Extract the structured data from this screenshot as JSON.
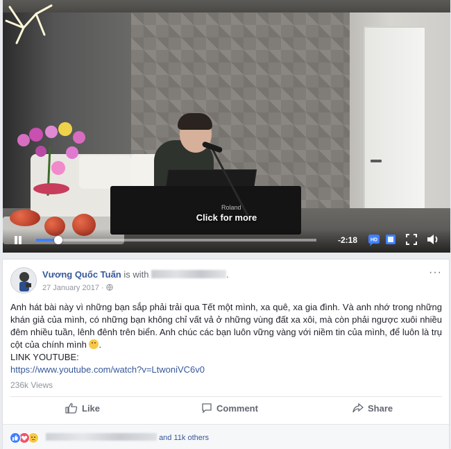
{
  "video": {
    "overlay_text": "Click for more",
    "time_remaining": "-2:18",
    "progress": 0.08,
    "piano_brand": "Roland",
    "hd_label": "HD"
  },
  "post": {
    "author": "Vương Quốc Tuấn",
    "with_text": "is with",
    "date": "27 January 2017",
    "privacy_icon": "globe-icon",
    "body": "Anh hát bài này vì những bạn sắp phải trải qua Tết một mình, xa quê, xa gia đình. Và anh nhớ trong những khán giả của mình, có những bạn không chỉ vất vả ở những vùng đất xa xôi, mà còn phải ngược xuôi nhiều đêm nhiều tuần, lênh đênh trên biển. Anh chúc các bạn luôn vững vàng với niềm tin của mình, để luôn là trụ cột của chính mình",
    "link_label": "LINK YOUTUBE:",
    "link_url": "https://www.youtube.com/watch?v=LtwoniVC6v0",
    "views": "236k Views"
  },
  "actions": {
    "like": "Like",
    "comment": "Comment",
    "share": "Share"
  },
  "reactions": {
    "others": "and 11k others"
  },
  "colors": {
    "brand_blue": "#365899",
    "progress_blue": "#4080ff"
  }
}
